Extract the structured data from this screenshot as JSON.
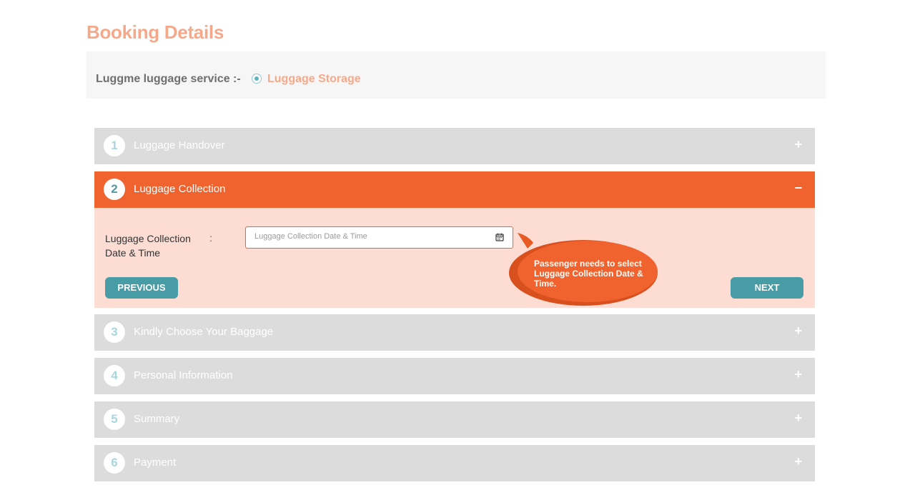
{
  "page": {
    "title": "Booking Details"
  },
  "service": {
    "label": "Luggme luggage service :-",
    "option": "Luggage Storage"
  },
  "steps": [
    {
      "number": "1",
      "title": "Luggage Handover",
      "toggle": "+"
    },
    {
      "number": "2",
      "title": "Luggage Collection",
      "toggle": "−"
    },
    {
      "number": "3",
      "title": "Kindly Choose Your Baggage",
      "toggle": "+"
    },
    {
      "number": "4",
      "title": "Personal Information",
      "toggle": "+"
    },
    {
      "number": "5",
      "title": "Summary",
      "toggle": "+"
    },
    {
      "number": "6",
      "title": "Payment",
      "toggle": "+"
    }
  ],
  "collection_panel": {
    "field_label": "Luggage Collection Date & Time",
    "colon": ":",
    "placeholder": "Luggage Collection Date & Time",
    "previous_label": "PREVIOUS",
    "next_label": "NEXT"
  },
  "callout": {
    "text": "Passenger needs to select Luggage Collection Date & Time."
  },
  "colors": {
    "accent": "#f0632f",
    "teal": "#479ca6",
    "title": "#f5a98a",
    "panel_bg": "#fddcd3",
    "collapsed_bg": "#dcdcdc"
  }
}
